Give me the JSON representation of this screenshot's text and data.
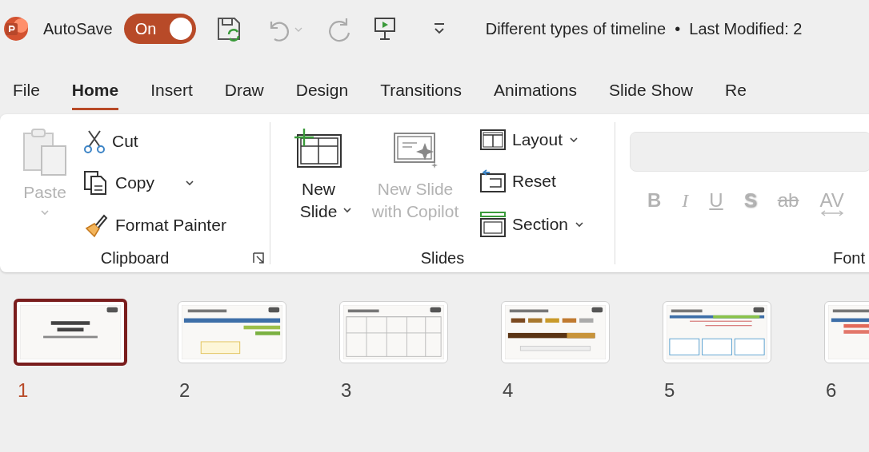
{
  "title_bar": {
    "autosave_label": "AutoSave",
    "autosave": {
      "label": "On",
      "on": true
    },
    "document_title": "Different types of timeline  •  Last Modified: 2"
  },
  "tabs": [
    {
      "label": "File",
      "selected": false
    },
    {
      "label": "Home",
      "selected": true
    },
    {
      "label": "Insert",
      "selected": false
    },
    {
      "label": "Draw",
      "selected": false
    },
    {
      "label": "Design",
      "selected": false
    },
    {
      "label": "Transitions",
      "selected": false
    },
    {
      "label": "Animations",
      "selected": false
    },
    {
      "label": "Slide Show",
      "selected": false
    },
    {
      "label": "Re",
      "selected": false
    }
  ],
  "ribbon": {
    "clipboard": {
      "label": "Clipboard",
      "paste": {
        "label": "Paste",
        "disabled": true
      },
      "cut": "Cut",
      "copy": "Copy",
      "format_painter": "Format Painter"
    },
    "slides": {
      "label": "Slides",
      "new_slide": "New Slide",
      "copilot": {
        "label": "New Slide with Copilot",
        "disabled": true
      },
      "layout": "Layout",
      "reset": "Reset",
      "section": "Section"
    },
    "font": {
      "label": "Font",
      "formats": [
        {
          "label": "B",
          "kind": "bold",
          "disabled": true
        },
        {
          "label": "I",
          "kind": "italic",
          "disabled": true
        },
        {
          "label": "U",
          "kind": "underline",
          "disabled": true
        },
        {
          "label": "S",
          "kind": "shadow",
          "disabled": true
        },
        {
          "label": "ab",
          "kind": "strike",
          "disabled": true
        },
        {
          "label": "AV",
          "kind": "spacing",
          "disabled": true
        }
      ]
    }
  },
  "slides": [
    {
      "number": "1",
      "selected": true,
      "kind": "picture"
    },
    {
      "number": "2",
      "selected": false,
      "kind": "picture"
    },
    {
      "number": "3",
      "selected": false,
      "kind": "picture"
    },
    {
      "number": "4",
      "selected": false,
      "kind": "picture"
    },
    {
      "number": "5",
      "selected": false,
      "kind": "picture"
    },
    {
      "number": "6",
      "selected": false,
      "kind": "picture"
    }
  ]
}
